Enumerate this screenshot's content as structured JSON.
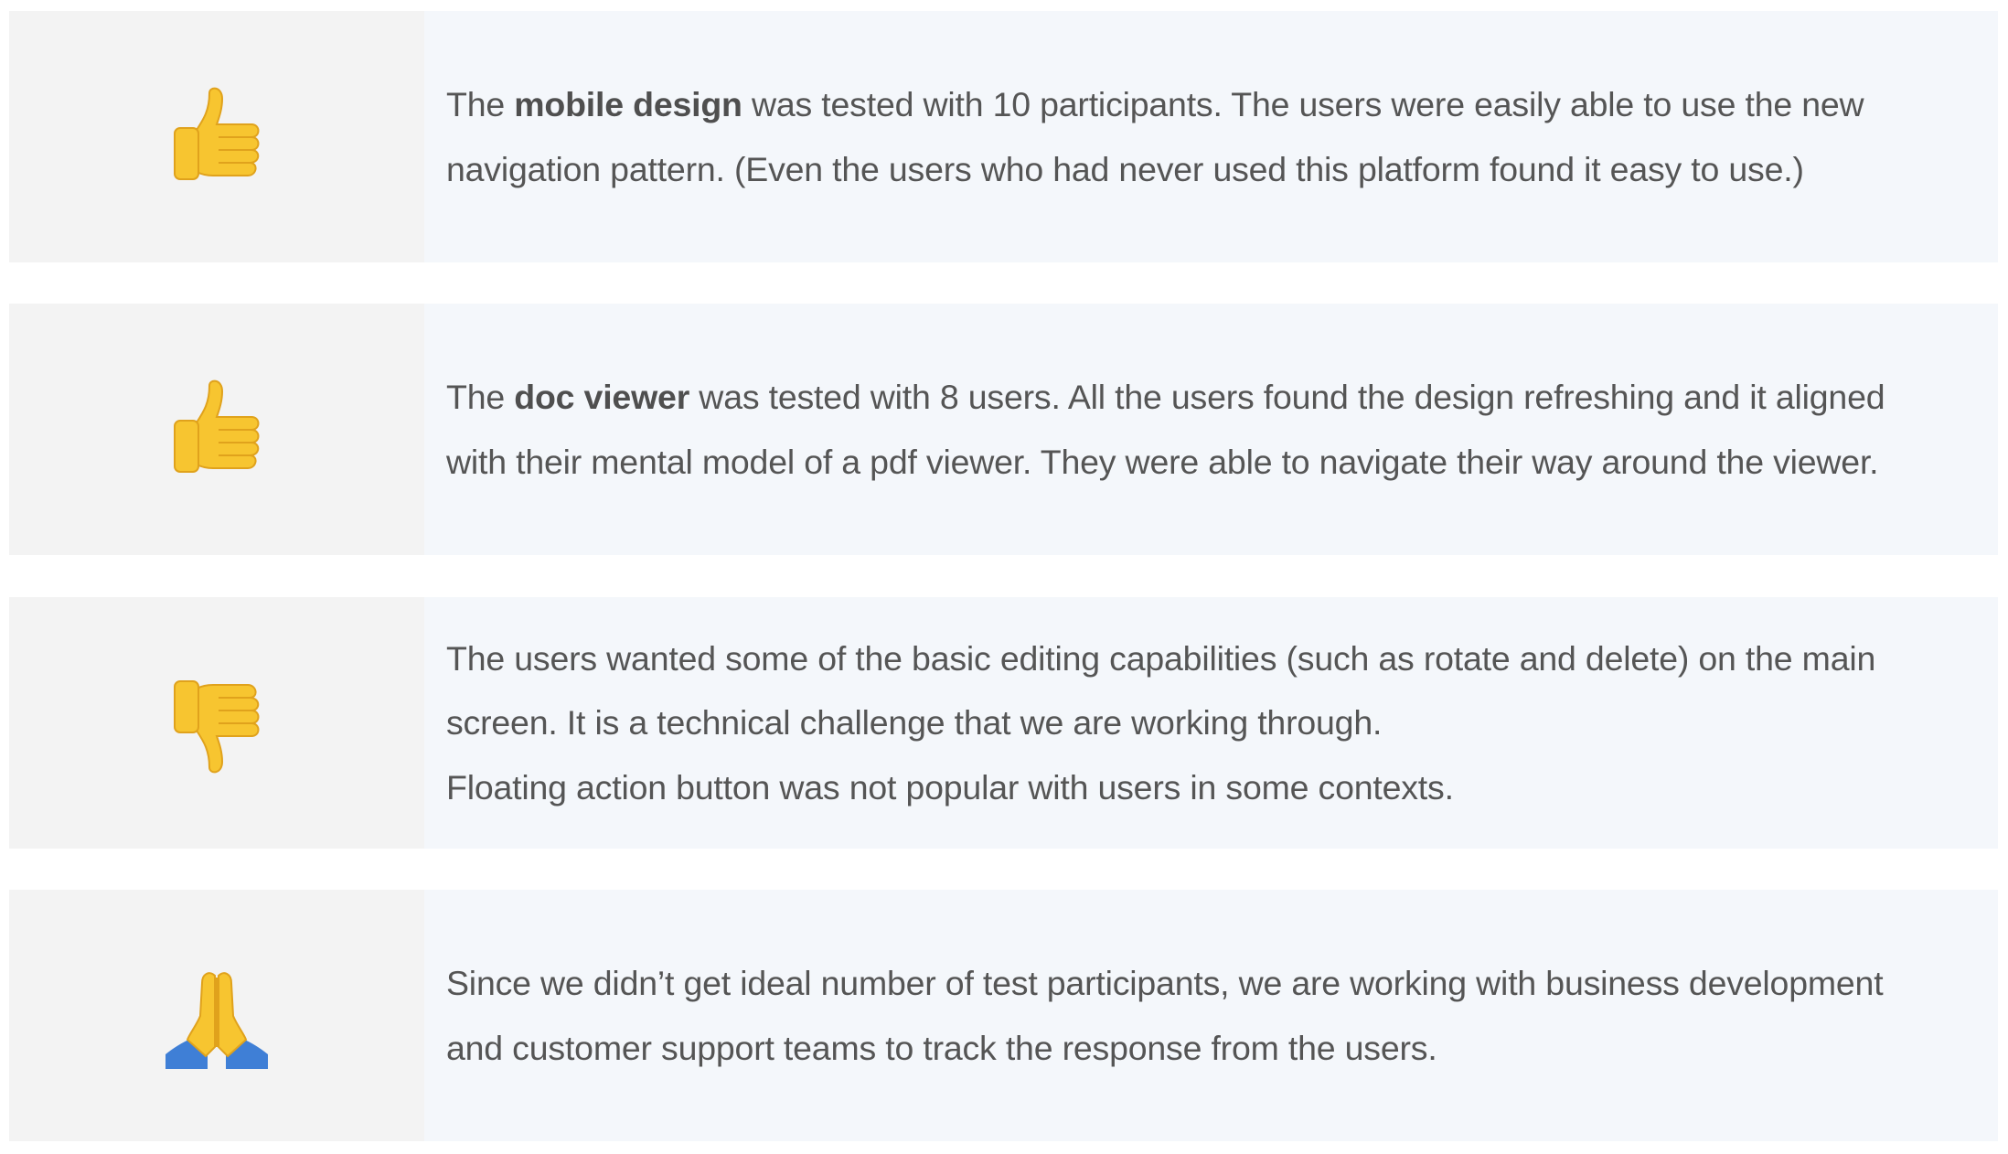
{
  "items": [
    {
      "icon": "thumbs-up-icon",
      "line1_prefix": "The ",
      "line1_bold": "mobile design",
      "line1_suffix": " was tested with 10 participants. The users were easily able to use the new",
      "line2": "navigation pattern. (Even the users who had never used this platform found it easy to use.)"
    },
    {
      "icon": "thumbs-up-icon",
      "line1_prefix": "The ",
      "line1_bold": "doc viewer",
      "line1_suffix": " was tested with 8 users. All the users found the design refreshing and it aligned",
      "line2": "with their mental model of a pdf viewer. They were able to navigate their way around the viewer."
    },
    {
      "icon": "thumbs-down-icon",
      "line1": "The users wanted some of the basic editing capabilities (such as rotate and delete) on the main",
      "line2": "screen. It is a technical challenge that we are working through.",
      "line3": "Floating action button was not popular with users in some contexts."
    },
    {
      "icon": "folded-hands-icon",
      "line1": "Since we didn’t get ideal number of test participants, we are working with business development",
      "line2": "and customer support teams to track the response from the users."
    }
  ],
  "colors": {
    "icon_bg": "#f3f3f3",
    "text_bg": "#f4f7fb",
    "text": "#555555",
    "emoji_yellow": "#f7c530",
    "emoji_blue": "#3f7fd6"
  }
}
